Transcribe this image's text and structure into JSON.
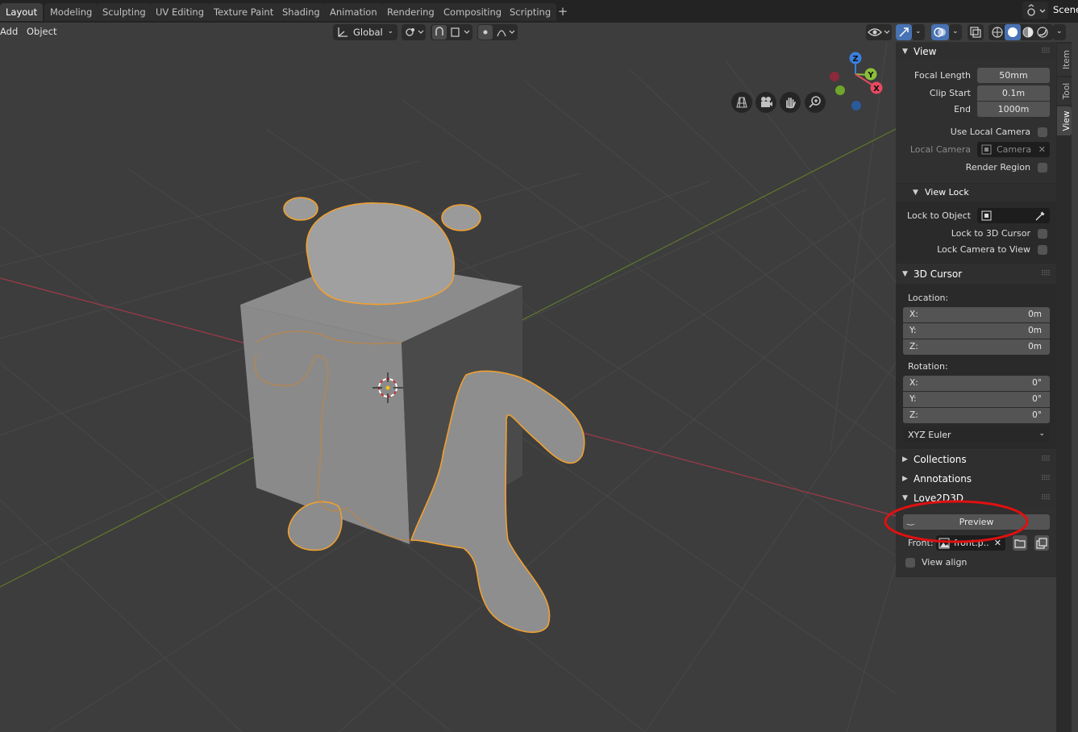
{
  "workspace_tabs": [
    "Layout",
    "Modeling",
    "Sculpting",
    "UV Editing",
    "Texture Paint",
    "Shading",
    "Animation",
    "Rendering",
    "Compositing",
    "Scripting"
  ],
  "active_tab": "Layout",
  "plus_label": "+",
  "scene_label": "Scene",
  "header": {
    "menus": [
      "Add",
      "Object"
    ],
    "transform_orientation": "Global"
  },
  "sidebar_tabs": [
    "Item",
    "Tool",
    "View"
  ],
  "active_sidebar_tab": "View",
  "view_panel": {
    "title": "View",
    "focal_length_label": "Focal Length",
    "focal_length": "50mm",
    "clip_start_label": "Clip Start",
    "clip_start": "0.1m",
    "clip_end_label": "End",
    "clip_end": "1000m",
    "use_local_camera_label": "Use Local Camera",
    "local_camera_label": "Local Camera",
    "local_camera_value": "Camera",
    "render_region_label": "Render Region"
  },
  "view_lock": {
    "title": "View Lock",
    "lock_to_object_label": "Lock to Object",
    "lock_to_cursor_label": "Lock to 3D Cursor",
    "lock_camera_label": "Lock Camera to View"
  },
  "cursor_panel": {
    "title": "3D Cursor",
    "location_label": "Location:",
    "loc_x_label": "X:",
    "loc_x": "0m",
    "loc_y_label": "Y:",
    "loc_y": "0m",
    "loc_z_label": "Z:",
    "loc_z": "0m",
    "rotation_label": "Rotation:",
    "rot_x_label": "X:",
    "rot_x": "0°",
    "rot_y_label": "Y:",
    "rot_y": "0°",
    "rot_z_label": "Z:",
    "rot_z": "0°",
    "rotation_mode": "XYZ Euler"
  },
  "collections_title": "Collections",
  "annotations_title": "Annotations",
  "love2d3d": {
    "title": "Love2D3D",
    "preview_label": "Preview",
    "front_label": "Front:",
    "front_file": "front.p..",
    "view_align_label": "View align"
  },
  "gizmo": {
    "x_label": "X",
    "y_label": "Y",
    "z_label": "Z"
  },
  "colors": {
    "accent_blue": "#4772b3",
    "selection_orange": "#f0a030",
    "highlight_circle": "#e01010",
    "x_axis": "#e84a5f",
    "y_axis": "#8bbf3a",
    "z_axis": "#3a7fe0"
  }
}
